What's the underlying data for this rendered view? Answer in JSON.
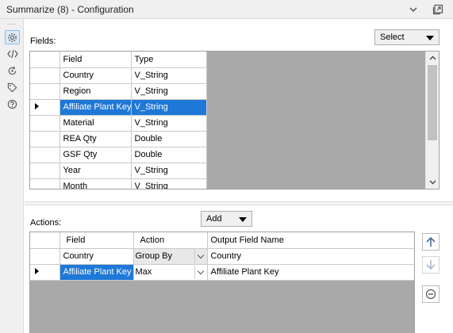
{
  "window": {
    "title": "Summarize (8) - Configuration",
    "collapse_icon": "chevron-down-icon",
    "undock_icon": "undock-icon"
  },
  "sidebar": {
    "overflow_label": "...",
    "items": [
      {
        "name": "configuration",
        "icon": "gear-icon",
        "active": true
      },
      {
        "name": "xml-view",
        "icon": "code-icon",
        "active": false
      },
      {
        "name": "annotation",
        "icon": "refresh-icon",
        "active": false
      },
      {
        "name": "tags",
        "icon": "tag-icon",
        "active": false
      },
      {
        "name": "help",
        "icon": "help-icon",
        "active": false
      }
    ]
  },
  "fields": {
    "label": "Fields:",
    "select_button": "Select",
    "columns": [
      "Field",
      "Type"
    ],
    "rows": [
      {
        "field": "Country",
        "type": "V_String",
        "selected": false
      },
      {
        "field": "Region",
        "type": "V_String",
        "selected": false
      },
      {
        "field": "Affiliate Plant Key",
        "type": "V_String",
        "selected": true
      },
      {
        "field": "Material",
        "type": "V_String",
        "selected": false
      },
      {
        "field": "REA Qty",
        "type": "Double",
        "selected": false
      },
      {
        "field": "GSF Qty",
        "type": "Double",
        "selected": false
      },
      {
        "field": "Year",
        "type": "V_String",
        "selected": false
      },
      {
        "field": "Month",
        "type": "V_String",
        "selected": false
      }
    ]
  },
  "actions": {
    "label": "Actions:",
    "add_button": "Add",
    "columns": [
      "Field",
      "Action",
      "Output Field Name"
    ],
    "rows": [
      {
        "field": "Country",
        "action": "Group By",
        "output": "Country",
        "selected": false
      },
      {
        "field": "Affiliate Plant Key",
        "action": "Max",
        "output": "Affiliate Plant Key",
        "selected": true
      }
    ],
    "move_up_icon": "arrow-up-icon",
    "move_down_icon": "arrow-down-icon",
    "remove_icon": "minus-circle-icon"
  },
  "colors": {
    "selection": "#1e78d7",
    "grid_empty": "#a9a9a9",
    "chrome": "#f0f0f0"
  }
}
